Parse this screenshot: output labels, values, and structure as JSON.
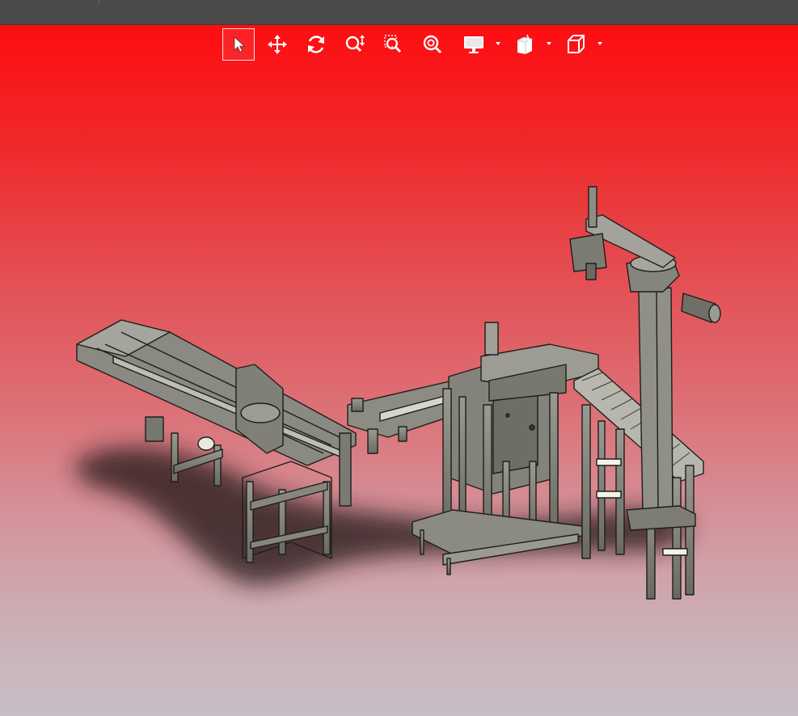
{
  "theme": {
    "titlebar_color": "#4a4a4a",
    "viewport_top_color": "#fe0d10",
    "viewport_bottom_color": "#c7bec6",
    "icon_color": "#ffffff"
  },
  "toolbar": {
    "items": [
      {
        "id": "select",
        "icon": "cursor-arrow-icon",
        "active": true,
        "has_dropdown": false
      },
      {
        "id": "pan",
        "icon": "pan-move-icon",
        "active": false,
        "has_dropdown": false
      },
      {
        "id": "rotate",
        "icon": "rotate-view-icon",
        "active": false,
        "has_dropdown": false
      },
      {
        "id": "zoom",
        "icon": "zoom-in-out-icon",
        "active": false,
        "has_dropdown": false
      },
      {
        "id": "zoom-window",
        "icon": "zoom-to-area-icon",
        "active": false,
        "has_dropdown": false
      },
      {
        "id": "zoom-fit",
        "icon": "zoom-to-fit-icon",
        "active": false,
        "has_dropdown": false
      },
      {
        "id": "display",
        "icon": "monitor-display-icon",
        "active": false,
        "has_dropdown": true
      },
      {
        "id": "section",
        "icon": "section-view-icon",
        "active": false,
        "has_dropdown": true
      },
      {
        "id": "view-orientation",
        "icon": "view-cube-icon",
        "active": false,
        "has_dropdown": true
      }
    ]
  },
  "scene": {
    "description_visible": false,
    "model": "machine-assembly-3d",
    "model_color": "#7a7a72"
  }
}
